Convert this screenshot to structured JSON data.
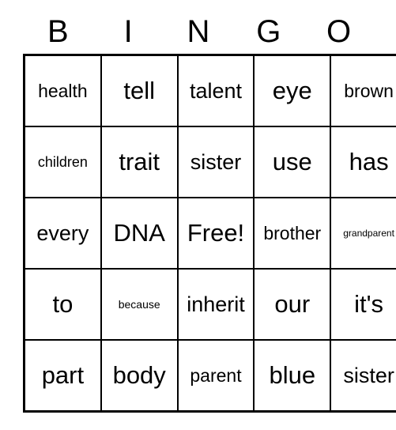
{
  "card": {
    "title": "BINGO",
    "headers": [
      "B",
      "I",
      "N",
      "G",
      "O"
    ],
    "free_space_label": "Free!",
    "colors": {
      "background": "#ffffff",
      "text": "#000000",
      "border": "#000000"
    },
    "rows": [
      [
        {
          "text": "health",
          "size": "s-md"
        },
        {
          "text": "tell",
          "size": "s-xl"
        },
        {
          "text": "talent",
          "size": "s-lg"
        },
        {
          "text": "eye",
          "size": "s-xl"
        },
        {
          "text": "brown",
          "size": "s-md"
        }
      ],
      [
        {
          "text": "children",
          "size": "s-sm"
        },
        {
          "text": "trait",
          "size": "s-xl"
        },
        {
          "text": "sister",
          "size": "s-lg"
        },
        {
          "text": "use",
          "size": "s-xl"
        },
        {
          "text": "has",
          "size": "s-xl"
        }
      ],
      [
        {
          "text": "every",
          "size": "s-lg"
        },
        {
          "text": "DNA",
          "size": "s-xl"
        },
        {
          "text": "Free!",
          "size": "s-xl"
        },
        {
          "text": "brother",
          "size": "s-md"
        },
        {
          "text": "grandparent",
          "size": "s-xxs"
        }
      ],
      [
        {
          "text": "to",
          "size": "s-xl"
        },
        {
          "text": "because",
          "size": "s-xs"
        },
        {
          "text": "inherit",
          "size": "s-lg"
        },
        {
          "text": "our",
          "size": "s-xl"
        },
        {
          "text": "it's",
          "size": "s-xl"
        }
      ],
      [
        {
          "text": "part",
          "size": "s-xl"
        },
        {
          "text": "body",
          "size": "s-xl"
        },
        {
          "text": "parent",
          "size": "s-md"
        },
        {
          "text": "blue",
          "size": "s-xl"
        },
        {
          "text": "sister",
          "size": "s-lg"
        }
      ]
    ]
  }
}
